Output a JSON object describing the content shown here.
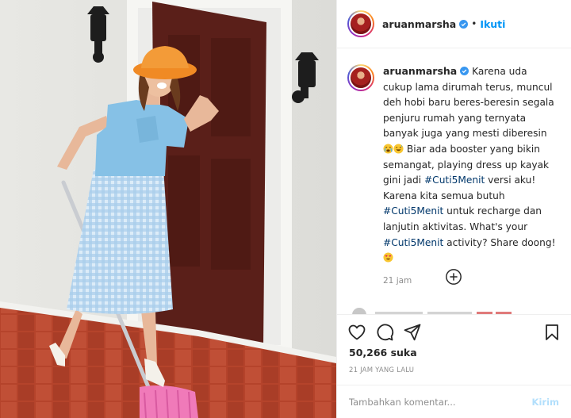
{
  "header": {
    "username": "aruanmarsha",
    "separator": "•",
    "follow_label": "Ikuti"
  },
  "caption": {
    "username": "aruanmarsha",
    "text_1": "Karena uda cukup lama dirumah terus, muncul deh hobi baru beres-beresin segala penjuru rumah yang ternyata banyak juga yang mesti diberesin",
    "text_2": "Biar ada booster yang bikin semangat, playing dress up kayak gini jadi",
    "hashtag_1": "#Cuti5Menit",
    "text_3": "versi aku! Karena kita semua butuh",
    "hashtag_2": "#Cuti5Menit",
    "text_4": "untuk recharge dan lanjutin aktivitas. What's your",
    "hashtag_3": "#Cuti5Menit",
    "text_5": "activity? Share doong!",
    "time_ago": "21 jam"
  },
  "engagement": {
    "likes": "50,266 suka",
    "post_date": "21 JAM YANG LALU"
  },
  "comment_box": {
    "placeholder": "Tambahkan komentar...",
    "post_label": "Kirim"
  },
  "colors": {
    "accent": "#0095f6",
    "hashtag": "#00376b",
    "muted": "#8e8e8e",
    "door": "#5a1f19",
    "hat": "#f08a24",
    "shirt": "#86c1e6",
    "skirt": "#b9d7ef",
    "mop": "#f07ab9",
    "floor": "#b5432b"
  },
  "icons": {
    "like": "heart-icon",
    "comment": "comment-icon",
    "share": "send-icon",
    "save": "bookmark-icon",
    "load_more": "plus-circle-icon",
    "verified": "verified-badge-icon"
  }
}
